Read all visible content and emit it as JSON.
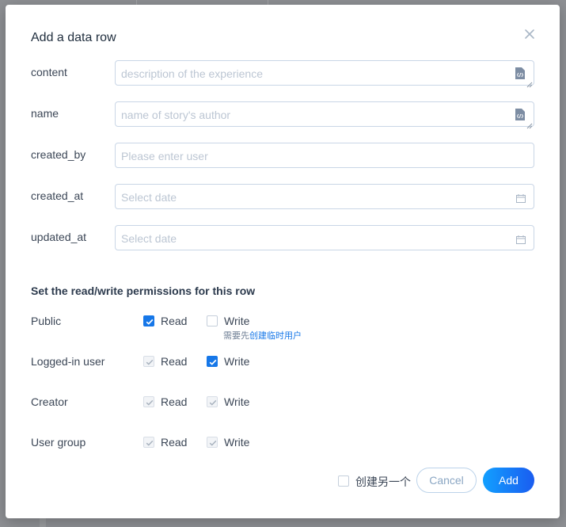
{
  "dialog": {
    "title": "Add a data row",
    "close_icon": "close-icon"
  },
  "fields": [
    {
      "label": "content",
      "placeholder": "description of the experience",
      "icon": "file-code-icon",
      "type": "textarea"
    },
    {
      "label": "name",
      "placeholder": "name of story's author",
      "icon": "file-code-icon",
      "type": "textarea"
    },
    {
      "label": "created_by",
      "placeholder": "Please enter user",
      "type": "text"
    },
    {
      "label": "created_at",
      "placeholder": "Select date",
      "icon": "calendar-icon",
      "type": "date"
    },
    {
      "label": "updated_at",
      "placeholder": "Select date",
      "icon": "calendar-icon",
      "type": "date"
    }
  ],
  "permissions": {
    "title": "Set the read/write permissions for this row",
    "read_label": "Read",
    "write_label": "Write",
    "rows": [
      {
        "label": "Public",
        "read": "checked",
        "write": "unchecked"
      },
      {
        "label": "Logged-in user",
        "read": "checked-disabled",
        "write": "checked"
      },
      {
        "label": "Creator",
        "read": "checked-disabled",
        "write": "checked-disabled"
      },
      {
        "label": "User group",
        "read": "checked-disabled",
        "write": "checked-disabled"
      }
    ],
    "hint_prefix": "需要先",
    "hint_link": "创建临时用户"
  },
  "footer": {
    "create_another_label": "创建另一个",
    "create_another_checked": false,
    "cancel_label": "Cancel",
    "add_label": "Add"
  },
  "colors": {
    "primary": "#1677e8",
    "overlay": "#8e9094"
  }
}
